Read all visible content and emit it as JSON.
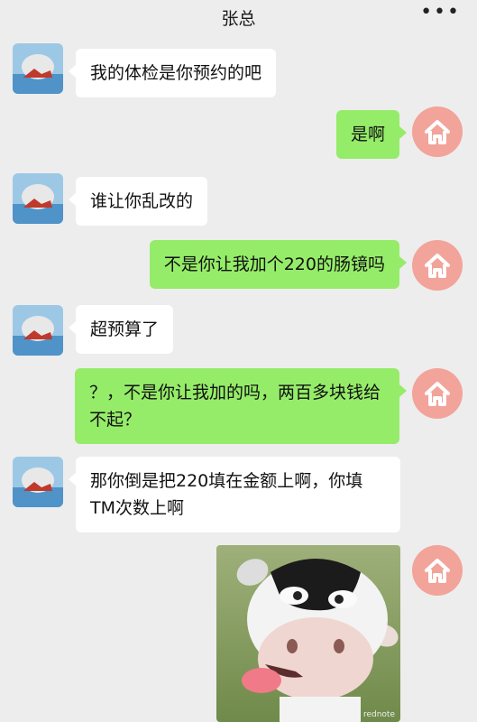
{
  "header": {
    "title": "张总",
    "more_icon": "more-dots-icon"
  },
  "messages": [
    {
      "side": "left",
      "text": "我的体检是你预约的吧"
    },
    {
      "side": "right",
      "text": "是啊"
    },
    {
      "side": "left",
      "text": "谁让你乱改的"
    },
    {
      "side": "right",
      "text": "不是你让我加个220的肠镜吗"
    },
    {
      "side": "left",
      "text": "超预算了"
    },
    {
      "side": "right",
      "text": "？，不是你让我加的吗，两百多块钱给不起？"
    },
    {
      "side": "left",
      "text": "那你倒是把220填在金额上啊，你填TM次数上啊"
    },
    {
      "side": "right",
      "type": "sticker",
      "description_icon": "cow-sticker"
    }
  ],
  "watermark": "rednote",
  "colors": {
    "background": "#ededed",
    "incoming_bubble": "#ffffff",
    "outgoing_bubble": "#95ec69",
    "self_avatar": "#f2a39a"
  }
}
